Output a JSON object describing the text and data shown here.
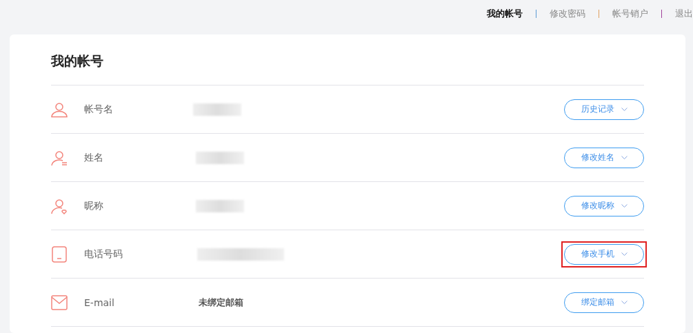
{
  "top_nav": [
    {
      "label": "我的帐号",
      "selected": true
    },
    {
      "label": "修改密码",
      "selected": false,
      "color": "#5b9bd5"
    },
    {
      "label": "帐号销户",
      "selected": false,
      "color": "#e0a060"
    },
    {
      "label": "退出",
      "selected": false,
      "color": "#a0409a"
    }
  ],
  "title": "我的帐号",
  "rows": [
    {
      "label": "帐号名",
      "value": {
        "kind": "redacted"
      },
      "button": "历史记录",
      "highlighted": false
    },
    {
      "label": "姓名",
      "value": {
        "kind": "redacted"
      },
      "button": "修改姓名",
      "highlighted": false
    },
    {
      "label": "昵称",
      "value": {
        "kind": "redacted"
      },
      "button": "修改昵称",
      "highlighted": false
    },
    {
      "label": "电话号码",
      "value": {
        "kind": "redacted"
      },
      "button": "修改手机",
      "highlighted": true
    },
    {
      "label": "E-mail",
      "value": {
        "kind": "text",
        "text": "未绑定邮箱"
      },
      "button": "绑定邮箱",
      "highlighted": false
    }
  ]
}
